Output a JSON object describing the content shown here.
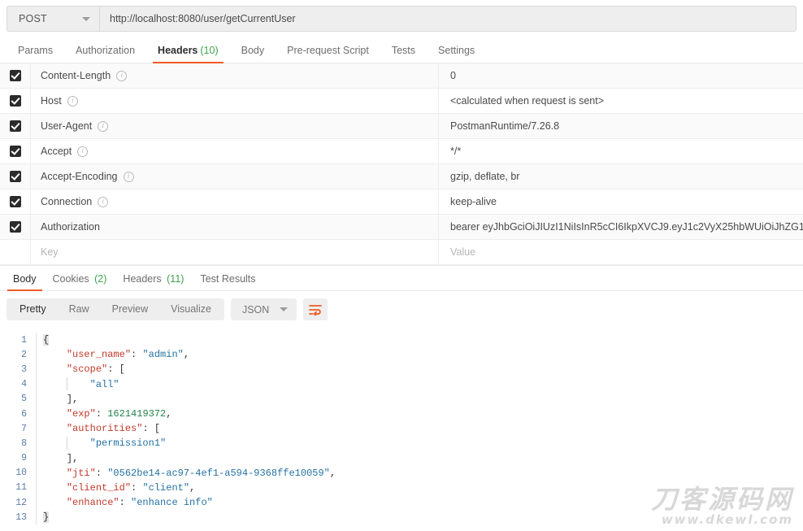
{
  "request": {
    "method": "POST",
    "url": "http://localhost:8080/user/getCurrentUser",
    "tabs": [
      {
        "label": "Params",
        "count": "",
        "active": false
      },
      {
        "label": "Authorization",
        "count": "",
        "active": false
      },
      {
        "label": "Headers",
        "count": "(10)",
        "active": true
      },
      {
        "label": "Body",
        "count": "",
        "active": false
      },
      {
        "label": "Pre-request Script",
        "count": "",
        "active": false
      },
      {
        "label": "Tests",
        "count": "",
        "active": false
      },
      {
        "label": "Settings",
        "count": "",
        "active": false
      }
    ]
  },
  "headers": {
    "key_placeholder": "Key",
    "value_placeholder": "Value",
    "rows": [
      {
        "checked": true,
        "key": "Content-Length",
        "info": true,
        "value": "0"
      },
      {
        "checked": true,
        "key": "Host",
        "info": true,
        "value": "<calculated when request is sent>"
      },
      {
        "checked": true,
        "key": "User-Agent",
        "info": true,
        "value": "PostmanRuntime/7.26.8"
      },
      {
        "checked": true,
        "key": "Accept",
        "info": true,
        "value": "*/*"
      },
      {
        "checked": true,
        "key": "Accept-Encoding",
        "info": true,
        "value": "gzip, deflate, br"
      },
      {
        "checked": true,
        "key": "Connection",
        "info": true,
        "value": "keep-alive"
      },
      {
        "checked": true,
        "key": "Authorization",
        "info": false,
        "value": "bearer eyJhbGciOiJIUzI1NiIsInR5cCI6IkpXVCJ9.eyJ1c2VyX25hbWUiOiJhZG1"
      }
    ]
  },
  "response": {
    "tabs": [
      {
        "label": "Body",
        "count": "",
        "active": true
      },
      {
        "label": "Cookies",
        "count": "(2)",
        "active": false
      },
      {
        "label": "Headers",
        "count": "(11)",
        "active": false
      },
      {
        "label": "Test Results",
        "count": "",
        "active": false
      }
    ],
    "view_modes": [
      {
        "label": "Pretty",
        "active": true
      },
      {
        "label": "Raw",
        "active": false
      },
      {
        "label": "Preview",
        "active": false
      },
      {
        "label": "Visualize",
        "active": false
      }
    ],
    "format": "JSON",
    "wrap_icon": "word-wrap-icon",
    "body_lines": [
      {
        "n": "1",
        "tokens": [
          {
            "t": "{",
            "c": "k-brace"
          }
        ]
      },
      {
        "n": "2",
        "indent": 1,
        "tokens": [
          {
            "t": "\"user_name\"",
            "c": "k-key"
          },
          {
            "t": ": ",
            "c": "k-punct"
          },
          {
            "t": "\"admin\"",
            "c": "k-str"
          },
          {
            "t": ",",
            "c": "k-punct"
          }
        ]
      },
      {
        "n": "3",
        "indent": 1,
        "tokens": [
          {
            "t": "\"scope\"",
            "c": "k-key"
          },
          {
            "t": ": [",
            "c": "k-punct"
          }
        ]
      },
      {
        "n": "4",
        "indent": 2,
        "guide": true,
        "tokens": [
          {
            "t": "\"all\"",
            "c": "k-str"
          }
        ]
      },
      {
        "n": "5",
        "indent": 1,
        "tokens": [
          {
            "t": "],",
            "c": "k-punct"
          }
        ]
      },
      {
        "n": "6",
        "indent": 1,
        "tokens": [
          {
            "t": "\"exp\"",
            "c": "k-key"
          },
          {
            "t": ": ",
            "c": "k-punct"
          },
          {
            "t": "1621419372",
            "c": "k-num"
          },
          {
            "t": ",",
            "c": "k-punct"
          }
        ]
      },
      {
        "n": "7",
        "indent": 1,
        "tokens": [
          {
            "t": "\"authorities\"",
            "c": "k-key"
          },
          {
            "t": ": [",
            "c": "k-punct"
          }
        ]
      },
      {
        "n": "8",
        "indent": 2,
        "guide": true,
        "tokens": [
          {
            "t": "\"permission1\"",
            "c": "k-str"
          }
        ]
      },
      {
        "n": "9",
        "indent": 1,
        "tokens": [
          {
            "t": "],",
            "c": "k-punct"
          }
        ]
      },
      {
        "n": "10",
        "indent": 1,
        "tokens": [
          {
            "t": "\"jti\"",
            "c": "k-key"
          },
          {
            "t": ": ",
            "c": "k-punct"
          },
          {
            "t": "\"0562be14-ac97-4ef1-a594-9368ffe10059\"",
            "c": "k-str"
          },
          {
            "t": ",",
            "c": "k-punct"
          }
        ]
      },
      {
        "n": "11",
        "indent": 1,
        "tokens": [
          {
            "t": "\"client_id\"",
            "c": "k-key"
          },
          {
            "t": ": ",
            "c": "k-punct"
          },
          {
            "t": "\"client\"",
            "c": "k-str"
          },
          {
            "t": ",",
            "c": "k-punct"
          }
        ]
      },
      {
        "n": "12",
        "indent": 1,
        "tokens": [
          {
            "t": "\"enhance\"",
            "c": "k-key"
          },
          {
            "t": ": ",
            "c": "k-punct"
          },
          {
            "t": "\"enhance info\"",
            "c": "k-str"
          }
        ]
      },
      {
        "n": "13",
        "tokens": [
          {
            "t": "}",
            "c": "k-brace"
          }
        ]
      }
    ]
  },
  "watermark": {
    "chinese": "刀客源码网",
    "english": "www.dkewl.com"
  },
  "colors": {
    "accent": "#ef5b25",
    "count_green": "#3ea34b",
    "json_key": "#c0392b",
    "json_string": "#2471a3",
    "json_number": "#1e8449",
    "line_number": "#5a7ca8"
  }
}
